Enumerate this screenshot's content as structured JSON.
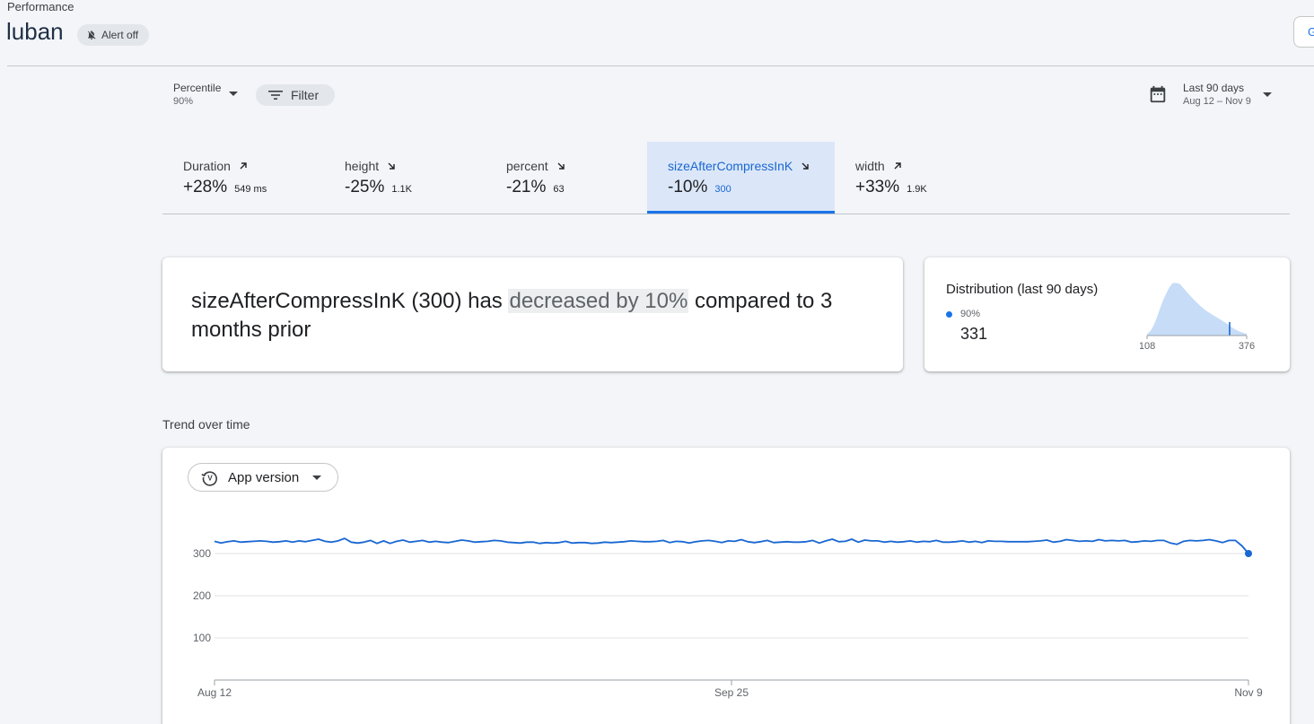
{
  "header": {
    "breadcrumb": "Performance",
    "app_title": "luban",
    "alert_badge": "Alert off",
    "right_button_label": "G"
  },
  "controls": {
    "percentile_label": "Percentile",
    "percentile_value": "90%",
    "filter_label": "Filter",
    "date_range_label": "Last 90 days",
    "date_range_value": "Aug 12 – Nov 9"
  },
  "metric_tabs": [
    {
      "name": "Duration",
      "change": "+28%",
      "value": "549 ms",
      "trend": "up"
    },
    {
      "name": "height",
      "change": "-25%",
      "value": "1.1K",
      "trend": "down"
    },
    {
      "name": "percent",
      "change": "-21%",
      "value": "63",
      "trend": "down"
    },
    {
      "name": "sizeAfterCompressInK",
      "change": "-10%",
      "value": "300",
      "trend": "down",
      "active": true
    },
    {
      "name": "width",
      "change": "+33%",
      "value": "1.9K",
      "trend": "up"
    }
  ],
  "summary": {
    "prefix": "sizeAfterCompressInK (300) has ",
    "highlight": "decreased by 10%",
    "suffix": " compared to 3 months prior"
  },
  "distribution": {
    "title": "Distribution (last 90 days)",
    "percentile": "90%",
    "value": "331",
    "min_label": "108",
    "max_label": "376"
  },
  "trend": {
    "section_label": "Trend over time",
    "version_button": "App version"
  },
  "colors": {
    "accent": "#1a73e8",
    "active_tab_bg": "#dbe7f8",
    "dist_fill": "#c6dcf7"
  },
  "chart_data": {
    "type": "line",
    "title": "",
    "xlabel": "",
    "ylabel": "",
    "ylim": [
      0,
      300
    ],
    "yticks": [
      100,
      200,
      300
    ],
    "xtick_labels": [
      "Aug 12",
      "Sep 25",
      "Nov 9"
    ],
    "grid": true,
    "series": [
      {
        "color": "#1967d2",
        "values": [
          329,
          325,
          328,
          330,
          327,
          328,
          329,
          330,
          329,
          327,
          328,
          330,
          327,
          330,
          328,
          331,
          334,
          329,
          327,
          330,
          336,
          327,
          325,
          327,
          331,
          324,
          330,
          324,
          329,
          332,
          327,
          329,
          331,
          327,
          329,
          327,
          326,
          329,
          332,
          330,
          327,
          328,
          329,
          331,
          330,
          327,
          326,
          325,
          327,
          327,
          324,
          326,
          325,
          326,
          329,
          325,
          326,
          326,
          324,
          325,
          327,
          326,
          327,
          328,
          330,
          329,
          328,
          328,
          329,
          331,
          326,
          329,
          328,
          325,
          328,
          330,
          331,
          329,
          326,
          330,
          329,
          333,
          328,
          326,
          328,
          331,
          326,
          327,
          328,
          327,
          327,
          328,
          331,
          325,
          330,
          334,
          328,
          329,
          334,
          327,
          332,
          330,
          330,
          327,
          329,
          327,
          328,
          330,
          327,
          329,
          328,
          331,
          327,
          327,
          328,
          330,
          327,
          329,
          326,
          330,
          329,
          329,
          328,
          328,
          328,
          328,
          329,
          330,
          332,
          327,
          329,
          333,
          331,
          329,
          330,
          329,
          333,
          330,
          331,
          330,
          331,
          327,
          328,
          330,
          329,
          331,
          331,
          325,
          322,
          329,
          331,
          330,
          331,
          333,
          330,
          326,
          331,
          331,
          318,
          300
        ]
      }
    ]
  }
}
